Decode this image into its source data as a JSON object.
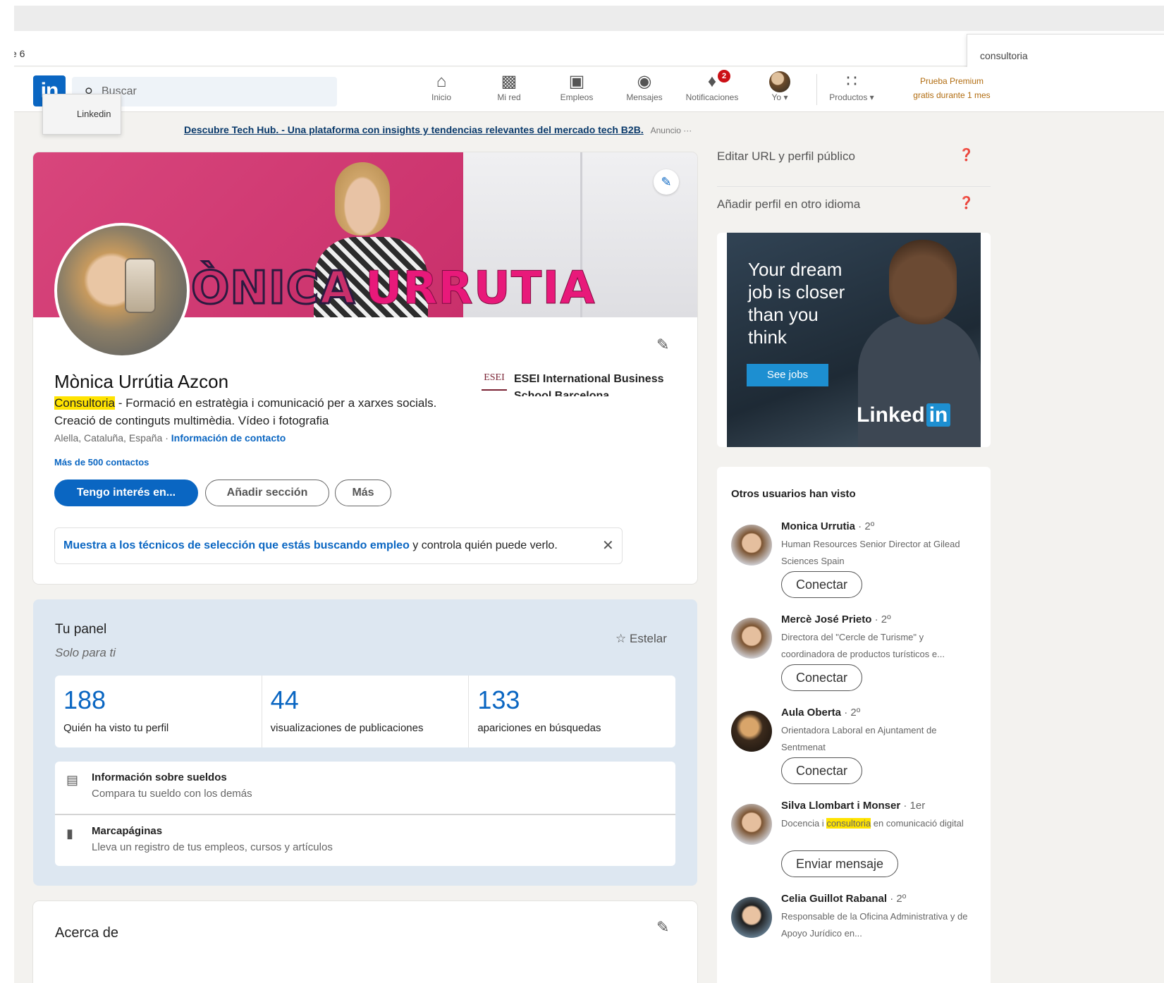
{
  "browser": {
    "tab_fragment": "e 6",
    "find_query": "consultoria"
  },
  "nav": {
    "logo": "in",
    "tooltip": "Linkedin",
    "search_placeholder": "Buscar",
    "items": [
      {
        "label": "Inicio",
        "icon": "home-icon"
      },
      {
        "label": "Mi red",
        "icon": "network-icon"
      },
      {
        "label": "Empleos",
        "icon": "briefcase-icon"
      },
      {
        "label": "Mensajes",
        "icon": "messaging-icon"
      },
      {
        "label": "Notificaciones",
        "icon": "bell-icon",
        "badge": "2"
      },
      {
        "label": "Yo ▾",
        "icon": "avatar"
      },
      {
        "label": "Productos ▾",
        "icon": "grid-icon"
      }
    ],
    "premium_line1": "Prueba Premium",
    "premium_line2": "gratis durante 1 mes"
  },
  "ad_banner": {
    "link": "Descubre Tech Hub. - Una plataforma con insights y tendencias relevantes del mercado tech B2B.",
    "label": "Anuncio ···"
  },
  "profile": {
    "cover_name_1": "ÒNICA",
    "cover_name_2": "URRUTIA",
    "name": "Mònica Urrútia Azcon",
    "headline_highlight": "Consultoria",
    "headline_rest": " - Formació en estratègia i comunicació per a xarxes socials. Creació de continguts multimèdia. Vídeo i fotografia",
    "location": "Alella, Cataluña, España · ",
    "contact_link": "Información de contacto",
    "connections": "Más de 500 contactos",
    "btn_primary": "Tengo interés en...",
    "btn_add": "Añadir sección",
    "btn_more": "Más",
    "school_logo": "ESEI",
    "school": "ESEI International Business School Barcelona",
    "jobs_link": "Muestra a los técnicos de selección que estás buscando empleo",
    "jobs_rest": " y controla quién puede verlo.",
    "jobs_close": "✕"
  },
  "panel": {
    "title": "Tu panel",
    "subtitle": "Solo para ti",
    "star_label": "Estelar",
    "stats": [
      {
        "value": "188",
        "label": "Quién ha visto tu perfil"
      },
      {
        "value": "44",
        "label": "visualizaciones de publicaciones"
      },
      {
        "value": "133",
        "label": "apariciones en búsquedas"
      }
    ],
    "tools": [
      {
        "title": "Información sobre sueldos",
        "desc": "Compara tu sueldo con los demás",
        "icon": "salary-icon"
      },
      {
        "title": "Marcapáginas",
        "desc": "Lleva un registro de tus empleos, cursos y artículos",
        "icon": "bookmark-icon"
      }
    ]
  },
  "about": {
    "title": "Acerca de"
  },
  "sidebar": {
    "edit_url": "Editar URL y perfil público",
    "add_language": "Añadir perfil en otro idioma",
    "ad": {
      "text": "Your dream job is closer than you think",
      "button": "See jobs",
      "brand": "Linked",
      "brand_in": "in"
    },
    "people_title": "Otros usuarios han visto",
    "people": [
      {
        "name": "Monica Urrutia",
        "degree": " · 2º",
        "desc": "Human Resources Senior Director at Gilead Sciences Spain",
        "action": "Conectar"
      },
      {
        "name": "Mercè José Prieto",
        "degree": " · 2º",
        "desc": "Directora del \"Cercle de Turisme\" y coordinadora de productos turísticos e...",
        "action": "Conectar"
      },
      {
        "name": "Aula Oberta",
        "degree": " · 2º",
        "desc": "Orientadora Laboral en Ajuntament de Sentmenat",
        "action": "Conectar"
      },
      {
        "name": "Silva Llombart i Monser",
        "degree": " · 1er",
        "desc_before": "Docencia i ",
        "desc_highlight": "consultoria",
        "desc_after": " en comunicació digital",
        "action": "Enviar mensaje"
      },
      {
        "name": "Celia Guillot Rabanal",
        "degree": " · 2º",
        "desc": "Responsable de la Oficina Administrativa y de Apoyo Jurídico en..."
      }
    ]
  },
  "colors": {
    "brand": "#0a66c2",
    "premium": "#b16c10",
    "panel_bg": "#dde7f1",
    "highlight": "#ffe300"
  }
}
